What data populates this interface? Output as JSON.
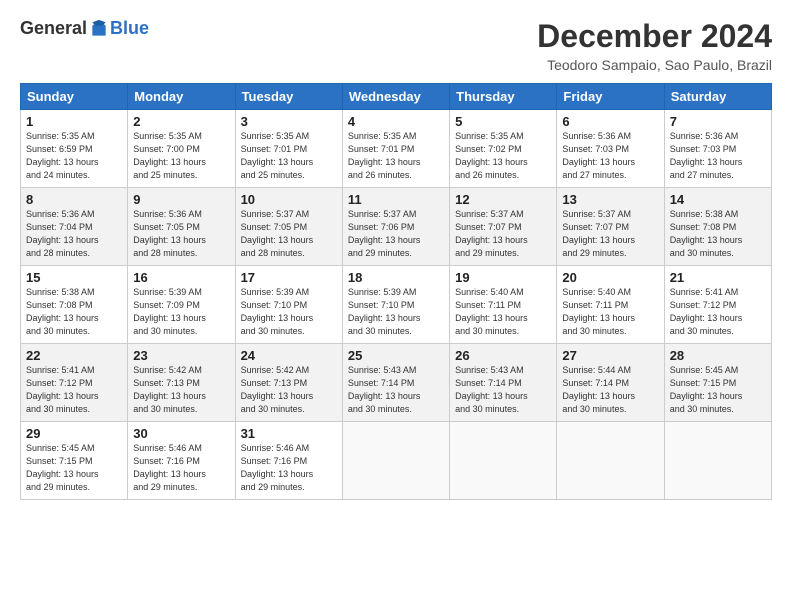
{
  "logo": {
    "general": "General",
    "blue": "Blue"
  },
  "title": "December 2024",
  "subtitle": "Teodoro Sampaio, Sao Paulo, Brazil",
  "headers": [
    "Sunday",
    "Monday",
    "Tuesday",
    "Wednesday",
    "Thursday",
    "Friday",
    "Saturday"
  ],
  "weeks": [
    [
      {
        "day": "1",
        "info": "Sunrise: 5:35 AM\nSunset: 6:59 PM\nDaylight: 13 hours\nand 24 minutes."
      },
      {
        "day": "2",
        "info": "Sunrise: 5:35 AM\nSunset: 7:00 PM\nDaylight: 13 hours\nand 25 minutes."
      },
      {
        "day": "3",
        "info": "Sunrise: 5:35 AM\nSunset: 7:01 PM\nDaylight: 13 hours\nand 25 minutes."
      },
      {
        "day": "4",
        "info": "Sunrise: 5:35 AM\nSunset: 7:01 PM\nDaylight: 13 hours\nand 26 minutes."
      },
      {
        "day": "5",
        "info": "Sunrise: 5:35 AM\nSunset: 7:02 PM\nDaylight: 13 hours\nand 26 minutes."
      },
      {
        "day": "6",
        "info": "Sunrise: 5:36 AM\nSunset: 7:03 PM\nDaylight: 13 hours\nand 27 minutes."
      },
      {
        "day": "7",
        "info": "Sunrise: 5:36 AM\nSunset: 7:03 PM\nDaylight: 13 hours\nand 27 minutes."
      }
    ],
    [
      {
        "day": "8",
        "info": "Sunrise: 5:36 AM\nSunset: 7:04 PM\nDaylight: 13 hours\nand 28 minutes."
      },
      {
        "day": "9",
        "info": "Sunrise: 5:36 AM\nSunset: 7:05 PM\nDaylight: 13 hours\nand 28 minutes."
      },
      {
        "day": "10",
        "info": "Sunrise: 5:37 AM\nSunset: 7:05 PM\nDaylight: 13 hours\nand 28 minutes."
      },
      {
        "day": "11",
        "info": "Sunrise: 5:37 AM\nSunset: 7:06 PM\nDaylight: 13 hours\nand 29 minutes."
      },
      {
        "day": "12",
        "info": "Sunrise: 5:37 AM\nSunset: 7:07 PM\nDaylight: 13 hours\nand 29 minutes."
      },
      {
        "day": "13",
        "info": "Sunrise: 5:37 AM\nSunset: 7:07 PM\nDaylight: 13 hours\nand 29 minutes."
      },
      {
        "day": "14",
        "info": "Sunrise: 5:38 AM\nSunset: 7:08 PM\nDaylight: 13 hours\nand 30 minutes."
      }
    ],
    [
      {
        "day": "15",
        "info": "Sunrise: 5:38 AM\nSunset: 7:08 PM\nDaylight: 13 hours\nand 30 minutes."
      },
      {
        "day": "16",
        "info": "Sunrise: 5:39 AM\nSunset: 7:09 PM\nDaylight: 13 hours\nand 30 minutes."
      },
      {
        "day": "17",
        "info": "Sunrise: 5:39 AM\nSunset: 7:10 PM\nDaylight: 13 hours\nand 30 minutes."
      },
      {
        "day": "18",
        "info": "Sunrise: 5:39 AM\nSunset: 7:10 PM\nDaylight: 13 hours\nand 30 minutes."
      },
      {
        "day": "19",
        "info": "Sunrise: 5:40 AM\nSunset: 7:11 PM\nDaylight: 13 hours\nand 30 minutes."
      },
      {
        "day": "20",
        "info": "Sunrise: 5:40 AM\nSunset: 7:11 PM\nDaylight: 13 hours\nand 30 minutes."
      },
      {
        "day": "21",
        "info": "Sunrise: 5:41 AM\nSunset: 7:12 PM\nDaylight: 13 hours\nand 30 minutes."
      }
    ],
    [
      {
        "day": "22",
        "info": "Sunrise: 5:41 AM\nSunset: 7:12 PM\nDaylight: 13 hours\nand 30 minutes."
      },
      {
        "day": "23",
        "info": "Sunrise: 5:42 AM\nSunset: 7:13 PM\nDaylight: 13 hours\nand 30 minutes."
      },
      {
        "day": "24",
        "info": "Sunrise: 5:42 AM\nSunset: 7:13 PM\nDaylight: 13 hours\nand 30 minutes."
      },
      {
        "day": "25",
        "info": "Sunrise: 5:43 AM\nSunset: 7:14 PM\nDaylight: 13 hours\nand 30 minutes."
      },
      {
        "day": "26",
        "info": "Sunrise: 5:43 AM\nSunset: 7:14 PM\nDaylight: 13 hours\nand 30 minutes."
      },
      {
        "day": "27",
        "info": "Sunrise: 5:44 AM\nSunset: 7:14 PM\nDaylight: 13 hours\nand 30 minutes."
      },
      {
        "day": "28",
        "info": "Sunrise: 5:45 AM\nSunset: 7:15 PM\nDaylight: 13 hours\nand 30 minutes."
      }
    ],
    [
      {
        "day": "29",
        "info": "Sunrise: 5:45 AM\nSunset: 7:15 PM\nDaylight: 13 hours\nand 29 minutes."
      },
      {
        "day": "30",
        "info": "Sunrise: 5:46 AM\nSunset: 7:16 PM\nDaylight: 13 hours\nand 29 minutes."
      },
      {
        "day": "31",
        "info": "Sunrise: 5:46 AM\nSunset: 7:16 PM\nDaylight: 13 hours\nand 29 minutes."
      },
      {
        "day": "",
        "info": ""
      },
      {
        "day": "",
        "info": ""
      },
      {
        "day": "",
        "info": ""
      },
      {
        "day": "",
        "info": ""
      }
    ]
  ]
}
